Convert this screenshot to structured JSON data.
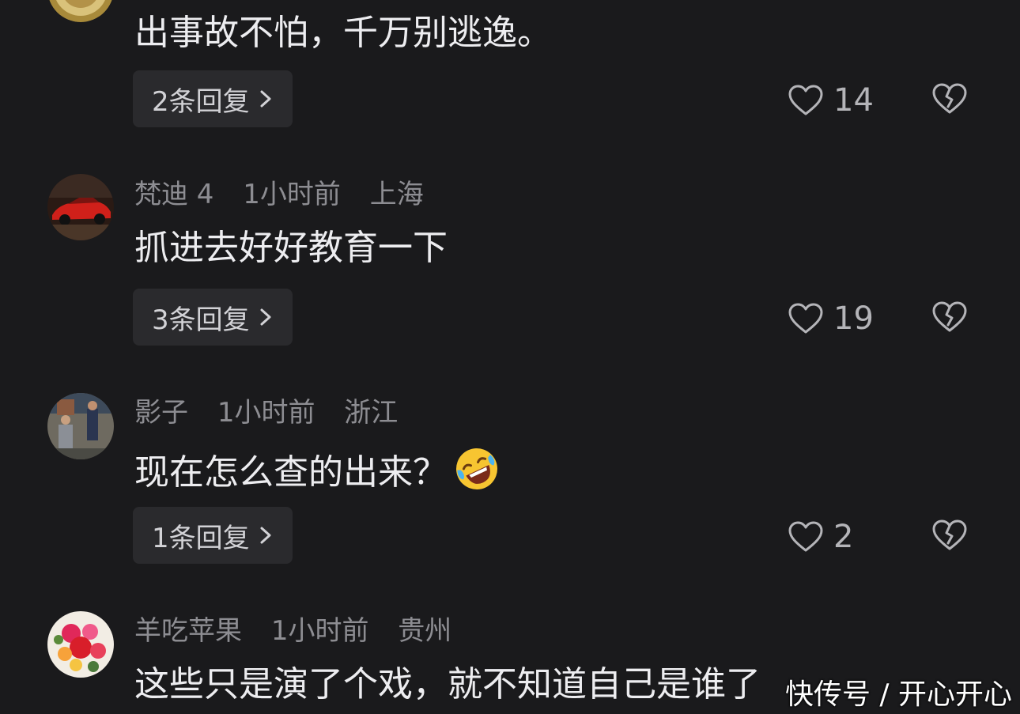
{
  "comments": [
    {
      "username": "",
      "time": "",
      "location": "",
      "text": "出事故不怕，千万别逃逸。",
      "replies_label": "2条回复",
      "likes": "14"
    },
    {
      "username": "梵迪 4",
      "time": "1小时前",
      "location": "上海",
      "text": "抓进去好好教育一下",
      "replies_label": "3条回复",
      "likes": "19"
    },
    {
      "username": "影子",
      "time": "1小时前",
      "location": "浙江",
      "text": "现在怎么查的出来？",
      "replies_label": "1条回复",
      "likes": "2",
      "emoji": "rolling-on-floor-laughing"
    },
    {
      "username": "羊吃苹果",
      "time": "1小时前",
      "location": "贵州",
      "text": "这些只是演了个戏，就不知道自己是谁了"
    }
  ],
  "watermark": "快传号 / 开心开心",
  "icons": {
    "like": "heart-outline-icon",
    "dislike": "broken-heart-icon",
    "reply_chevron": "chevron-right-icon"
  },
  "colors": {
    "background": "#1a1a1c",
    "reply_button": "#2a2a2d",
    "meta_text": "#8d8d92",
    "body_text": "#ededf0"
  }
}
